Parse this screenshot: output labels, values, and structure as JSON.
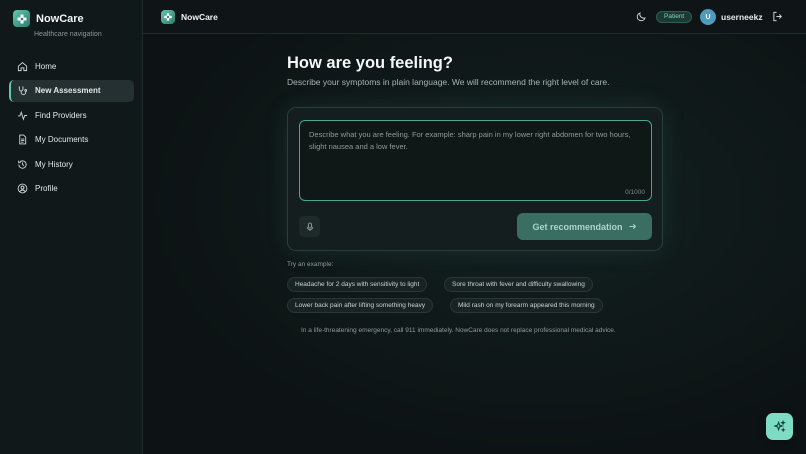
{
  "brand": {
    "name": "NowCare",
    "subtitle": "Healthcare navigation"
  },
  "sidebar": {
    "items": [
      {
        "label": "Home",
        "icon": "home-icon",
        "active": false
      },
      {
        "label": "New Assessment",
        "icon": "stethoscope-icon",
        "active": true
      },
      {
        "label": "Find Providers",
        "icon": "activity-icon",
        "active": false
      },
      {
        "label": "My Documents",
        "icon": "document-icon",
        "active": false
      },
      {
        "label": "My History",
        "icon": "history-icon",
        "active": false
      },
      {
        "label": "Profile",
        "icon": "user-circle-icon",
        "active": false
      }
    ]
  },
  "topbar": {
    "brand_name": "NowCare",
    "role_badge": "Patient",
    "avatar_initial": "U",
    "username": "userneekz"
  },
  "main": {
    "title": "How are you feeling?",
    "subtitle": "Describe your symptoms in plain language. We will recommend the right level of care.",
    "input": {
      "placeholder": "Describe what you are feeling. For example: sharp pain in my lower right abdomen for two hours, slight nausea and a low fever.",
      "value": "",
      "counter": "0/1000"
    },
    "submit_label": "Get recommendation",
    "examples_label": "Try an example:",
    "examples": [
      "Headache for 2 days with sensitivity to light",
      "Sore throat with fever and difficulty swallowing",
      "Lower back pain after lifting something heavy",
      "Mild rash on my forearm appeared this morning"
    ],
    "disclaimer": "In a life-threatening emergency, call 911 immediately. NowCare does not replace professional medical advice."
  },
  "colors": {
    "accent": "#5fc6b0",
    "background": "#0d1314",
    "sidebar_bg": "#111819",
    "submit_bg": "#3b6e62",
    "fab_bg": "#7fdcc4"
  }
}
